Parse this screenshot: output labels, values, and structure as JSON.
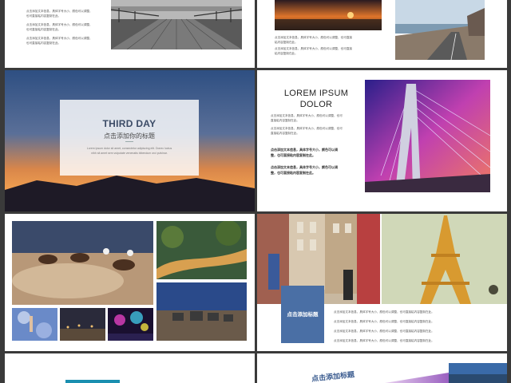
{
  "slides": {
    "s1": {
      "text_blocks": [
        "点击添加文本信息，具体字号大小，颜色可以调整，\n也可直接粘内容复制在此。",
        "点击添加文本信息，具体字号大小，颜色可以调整，\n也可直接粘内容复制在此。",
        "点击添加文本信息，具体字号大小，颜色可以调整，\n也可直接粘内容复制在此。"
      ]
    },
    "s2": {
      "text_blocks": [
        "点击添加文本信息，具体字号大小，颜色可以调整，也可直接\n粘内容复制在此。",
        "点击添加文本信息，具体字号大小，颜色可以调整，也可直接\n粘内容复制在此。"
      ]
    },
    "s3": {
      "title": "THIRD DAY",
      "subtitle": "点击添加你的标题",
      "body": "Lorem ipsum dolor sit amet, consectetur adipiscing elit. Donec luctus\nnibh sit amet sem vulputate venenatis bibendum orci pulvinar."
    },
    "s4": {
      "title": "LOREM IPSUM\nDOLOR",
      "text_blocks": [
        "点击添加文本信息，具体字号大小，颜色可以调整，也可\n直接粘内容复制在此。",
        "点击添加文本信息，具体字号大小，颜色可以调整，也可\n直接粘内容复制在此。"
      ],
      "bold_blocks": [
        "点击添加文本信息，具体字号大小，颜色可以调\n整，也可直接粘内容复制在此。",
        "点击添加文本信息，具体字号大小，颜色可以调\n整，也可直接粘内容复制在此。"
      ]
    },
    "s6": {
      "box_label": "点击添加标题",
      "text_blocks": [
        "点击添加文本信息，具体字号大小，颜色可以调整，也可直接粘内容复制在此。",
        "点击添加文本信息，具体字号大小，颜色可以调整，也可直接粘内容复制在此。",
        "点击添加文本信息，具体字号大小，颜色可以调整，也可直接粘内容复制在此。",
        "点击添加文本信息，具体字号大小，颜色可以调整，也可直接粘内容复制在此。"
      ]
    },
    "s8": {
      "title": "点击添加标题"
    }
  },
  "colors": {
    "slide_bg": "#ffffff",
    "page_bg": "#3a3a3a",
    "title_navy": "#3b4b66",
    "accent_blue": "#4a6fa5",
    "accent_teal": "#1a8fb0"
  }
}
